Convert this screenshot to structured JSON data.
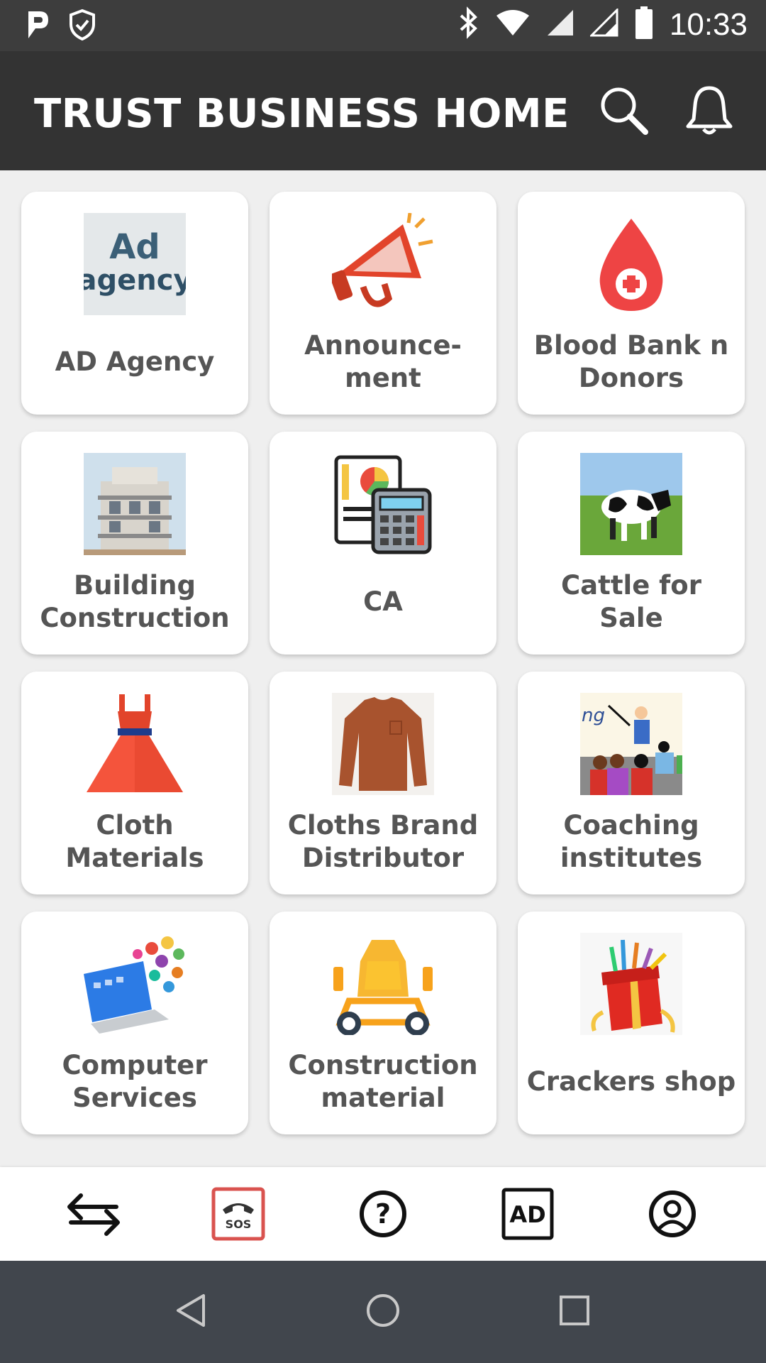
{
  "status_bar": {
    "time": "10:33",
    "left_icons": [
      "p-app-icon",
      "shield-check-icon"
    ],
    "right_icons": [
      "bluetooth-icon",
      "wifi-icon",
      "signal-icon",
      "signal-icon",
      "battery-icon"
    ]
  },
  "app_bar": {
    "title": "TRUST BUSINESS HOME",
    "actions": [
      "search-icon",
      "bell-icon"
    ]
  },
  "categories": [
    {
      "label": "AD Agency",
      "icon": "ad-agency-image"
    },
    {
      "label": "Announce-\nment",
      "icon": "megaphone-icon"
    },
    {
      "label": "Blood Bank n Donors",
      "icon": "blood-drop-icon"
    },
    {
      "label": "Building Construction",
      "icon": "building-image"
    },
    {
      "label": "CA",
      "icon": "calculator-report-icon"
    },
    {
      "label": "Cattle for Sale",
      "icon": "cow-image"
    },
    {
      "label": "Cloth Materials",
      "icon": "dress-icon"
    },
    {
      "label": "Cloths Brand Distributor",
      "icon": "sweater-image"
    },
    {
      "label": "Coaching institutes",
      "icon": "classroom-image"
    },
    {
      "label": "Computer Services",
      "icon": "laptop-apps-image"
    },
    {
      "label": "Construction material",
      "icon": "cement-mixer-icon"
    },
    {
      "label": "Crackers shop",
      "icon": "firecrackers-image"
    }
  ],
  "bottom_nav": [
    "swap-arrows-icon",
    "sos-phone-icon",
    "help-icon",
    "ad-icon",
    "account-icon"
  ],
  "colors": {
    "status_bar": "#3d3d3d",
    "app_bar": "#333333",
    "background": "#efefef",
    "card_label": "#555555",
    "sos_accent": "#d9534f",
    "system_nav": "#41464d"
  }
}
